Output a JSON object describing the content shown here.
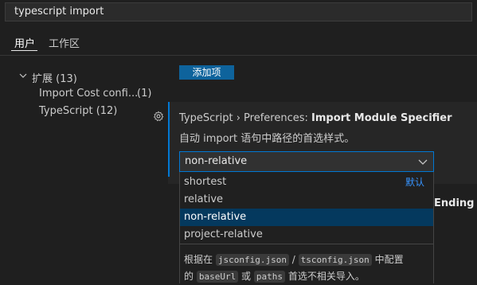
{
  "search": {
    "value": "typescript import"
  },
  "tabs": [
    {
      "label": "用户"
    },
    {
      "label": "工作区"
    }
  ],
  "tree": {
    "group": {
      "label": "扩展 (13)"
    },
    "items": [
      {
        "label": "Import Cost confi...",
        "count": "(1)"
      },
      {
        "label": "TypeScript (12)"
      }
    ]
  },
  "add_button": {
    "label": "添加项"
  },
  "setting": {
    "title_prefix": "TypeScript › Preferences: ",
    "title_main": "Import Module Specifier",
    "description": "自动 import 语句中路径的首选样式。",
    "value": "non-relative",
    "options": [
      {
        "label": "shortest",
        "tag": "默认"
      },
      {
        "label": "relative"
      },
      {
        "label": "non-relative"
      },
      {
        "label": "project-relative"
      }
    ],
    "selected_index": 2,
    "help": {
      "t1": "根据在",
      "c1": "jsconfig.json",
      "t2": "/",
      "c2": "tsconfig.json",
      "t3": "中配置",
      "t4": "的",
      "c3": "baseUrl",
      "t5": "或",
      "c4": "paths",
      "t6": "首选不相关导入。"
    }
  },
  "partial_heading": "Ending",
  "colors": {
    "accent": "#0078d4",
    "button": "#0e639c",
    "selected": "#04395e",
    "link": "#3794ff"
  }
}
